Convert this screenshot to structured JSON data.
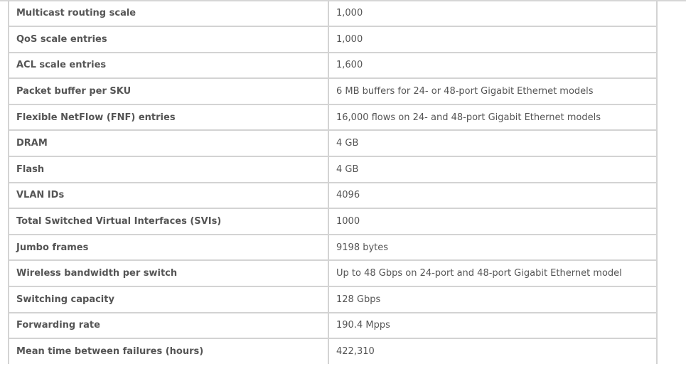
{
  "specs": {
    "rows": [
      {
        "label": "Multicast routing scale",
        "value": "1,000"
      },
      {
        "label": "QoS scale entries",
        "value": "1,000"
      },
      {
        "label": "ACL scale entries",
        "value": "1,600"
      },
      {
        "label": "Packet buffer per SKU",
        "value": "6 MB buffers for 24- or 48-port Gigabit Ethernet models"
      },
      {
        "label": "Flexible NetFlow (FNF) entries",
        "value": "16,000 flows on 24- and 48-port Gigabit Ethernet models"
      },
      {
        "label": "DRAM",
        "value": "4 GB"
      },
      {
        "label": "Flash",
        "value": "4 GB"
      },
      {
        "label": "VLAN IDs",
        "value": "4096"
      },
      {
        "label": "Total Switched Virtual Interfaces (SVIs)",
        "value": "1000"
      },
      {
        "label": "Jumbo frames",
        "value": "9198 bytes"
      },
      {
        "label": "Wireless bandwidth per switch",
        "value": "Up to 48 Gbps on 24-port and 48-port Gigabit Ethernet model"
      },
      {
        "label": "Switching capacity",
        "value": "128 Gbps"
      },
      {
        "label": "Forwarding rate",
        "value": "190.4 Mpps"
      },
      {
        "label": "Mean time between failures (hours)",
        "value": "422,310"
      }
    ]
  }
}
